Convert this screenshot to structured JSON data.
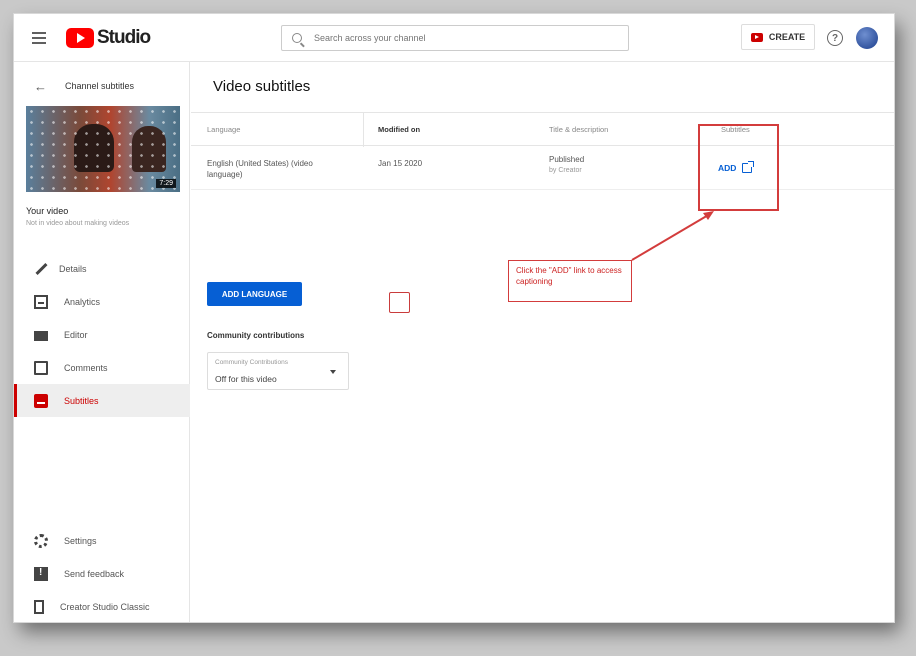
{
  "topbar": {
    "logo_text": "Studio",
    "search_placeholder": "Search across your channel",
    "create_label": "CREATE"
  },
  "sidebar": {
    "back_label": "Channel subtitles",
    "thumbnail_duration": "7:29",
    "your_video_label": "Your video",
    "video_title": "Not in video about making videos",
    "nav_items": [
      {
        "label": "Details",
        "icon": "pencil-icon"
      },
      {
        "label": "Analytics",
        "icon": "analytics-icon"
      },
      {
        "label": "Editor",
        "icon": "editor-icon"
      },
      {
        "label": "Comments",
        "icon": "comments-icon"
      },
      {
        "label": "Subtitles",
        "icon": "subtitles-icon",
        "active": true
      }
    ],
    "bottom_items": [
      {
        "label": "Settings",
        "icon": "gear-icon"
      },
      {
        "label": "Send feedback",
        "icon": "feedback-icon"
      },
      {
        "label": "Creator Studio Classic",
        "icon": "classic-icon"
      }
    ]
  },
  "main": {
    "title": "Video subtitles",
    "columns": [
      "Language",
      "Modified on",
      "Title & description",
      "Subtitles"
    ],
    "rows": [
      {
        "language": "English (United States) (video language)",
        "modified": "Jan 15 2020",
        "title_status": "Published",
        "title_sub": "by Creator",
        "subtitles_action": "ADD"
      }
    ],
    "add_language_label": "ADD LANGUAGE",
    "community_label": "Community contributions",
    "dropdown_floating_label": "Community Contributions",
    "dropdown_value": "Off for this video",
    "callout_text": "Click the \"ADD\" link to access captioning"
  },
  "colors": {
    "accent": "#065fd4",
    "brand": "#ff0000",
    "annotation": "#d33c3c"
  }
}
